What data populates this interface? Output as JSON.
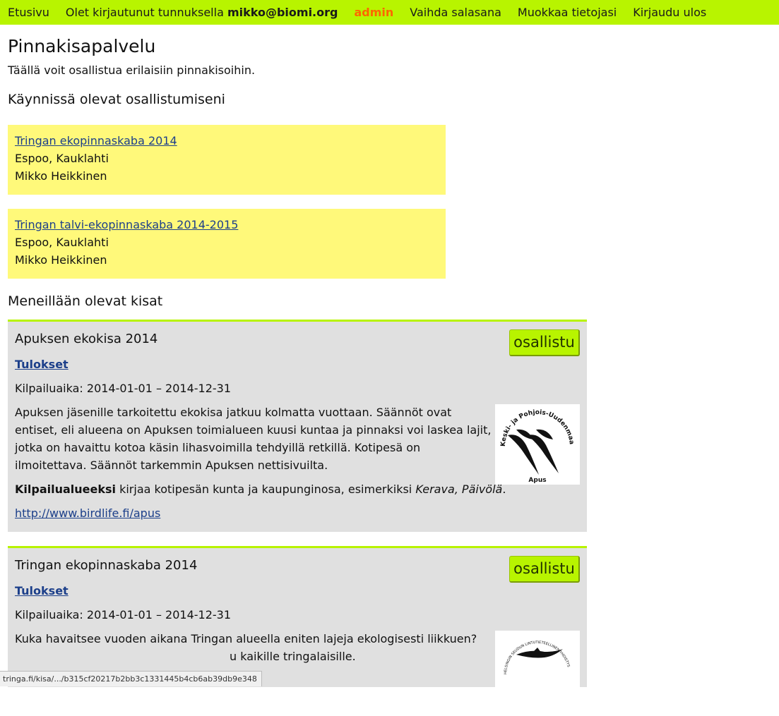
{
  "nav": {
    "home": "Etusivu",
    "login_prefix": "Olet kirjautunut tunnuksella ",
    "user_email": "mikko@biomi.org",
    "admin": "admin",
    "change_password": "Vaihda salasana",
    "edit_info": "Muokkaa tietojasi",
    "logout": "Kirjaudu ulos"
  },
  "page": {
    "title": "Pinnakisapalvelu",
    "intro": "Täällä voit osallistua erilaisiin pinnakisoihin."
  },
  "my_participations": {
    "heading": "Käynnissä olevat osallistumiseni",
    "items": [
      {
        "name": "Tringan ekopinnaskaba 2014",
        "location": "Espoo, Kauklahti",
        "person": "Mikko Heikkinen"
      },
      {
        "name": "Tringan talvi-ekopinnaskaba 2014-2015",
        "location": "Espoo, Kauklahti",
        "person": "Mikko Heikkinen"
      }
    ]
  },
  "contests": {
    "heading": "Meneillään olevat kisat",
    "join_label": "osallistu",
    "items": [
      {
        "title": "Apuksen ekokisa 2014",
        "results_label": "Tulokset",
        "period": "Kilpailuaika: 2014-01-01 – 2014-12-31",
        "description": "Apuksen jäsenille tarkoitettu ekokisa jatkuu kolmatta vuottaan. Säännöt ovat entiset, eli alueena on Apuksen toimialueen kuusi kuntaa ja pinnaksi voi laskea lajit, jotka on havaittu kotoa käsin lihasvoimilla tehdyillä retkillä. Kotipesä on ilmoitettava. Säännöt tarkemmin Apuksen nettisivuilta.",
        "region_label": "Kilpailualueeksi",
        "region_text": " kirjaa kotipesän kunta ja kaupunginosa, esimerkiksi ",
        "region_example": "Kerava, Päivölä",
        "region_end": ".",
        "url": "http://www.birdlife.fi/apus",
        "logo": {
          "ring_text": "Keski- ja Pohjois-Uudenmaan Lintuharrastajat ry",
          "name": "Apus",
          "icon": "swifts-logo"
        }
      },
      {
        "title": "Tringan ekopinnaskaba 2014",
        "results_label": "Tulokset",
        "period": "Kilpailuaika: 2014-01-01 – 2014-12-31",
        "description_line1": "Kuka havaitsee vuoden aikana Tringan alueella eniten lajeja ekologisesti liikkuen?",
        "description_line2_end": "u kaikille tringalaisille.",
        "logo": {
          "ring_text": "HELSINGIN SEUDUN LINTUTIETEELLINEN YHDISTYS",
          "icon": "tringa-logo"
        }
      }
    ]
  },
  "status_bar": {
    "url": "tringa.fi/kisa/.../b315cf20217b2bb3c1331445b4cb6ab39db9e348"
  }
}
